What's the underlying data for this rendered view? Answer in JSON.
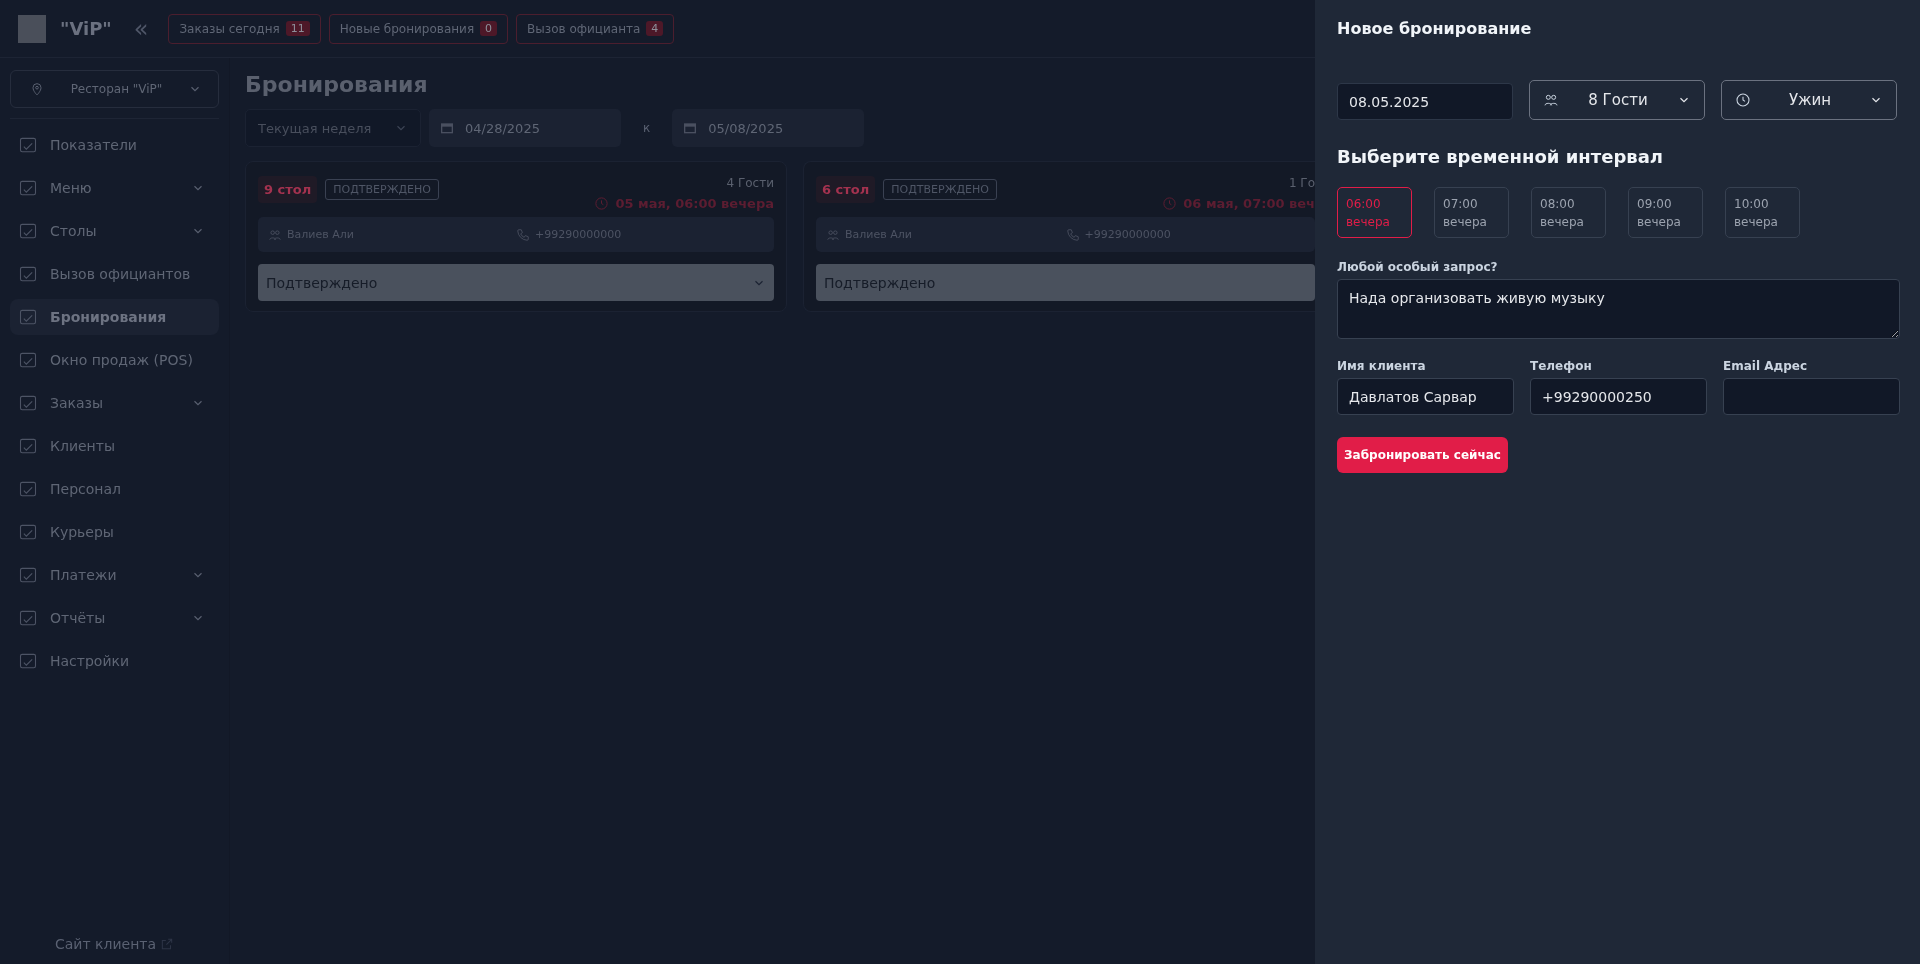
{
  "header": {
    "brand": "\"ViP\"",
    "collapse": "«",
    "badges": [
      {
        "label": "Заказы сегодня",
        "count": "11"
      },
      {
        "label": "Новые бронирования",
        "count": "0"
      },
      {
        "label": "Вызов официанта",
        "count": "4"
      }
    ]
  },
  "sidebar": {
    "restaurant": "Ресторан \"ViP\"",
    "items": [
      {
        "label": "Показатели",
        "expandable": false,
        "selected": false
      },
      {
        "label": "Меню",
        "expandable": true,
        "selected": false
      },
      {
        "label": "Столы",
        "expandable": true,
        "selected": false
      },
      {
        "label": "Вызов официантов",
        "expandable": false,
        "selected": false
      },
      {
        "label": "Бронирования",
        "expandable": false,
        "selected": true
      },
      {
        "label": "Окно продаж (POS)",
        "expandable": false,
        "selected": false
      },
      {
        "label": "Заказы",
        "expandable": true,
        "selected": false
      },
      {
        "label": "Клиенты",
        "expandable": false,
        "selected": false
      },
      {
        "label": "Персонал",
        "expandable": false,
        "selected": false
      },
      {
        "label": "Курьеры",
        "expandable": false,
        "selected": false
      },
      {
        "label": "Платежи",
        "expandable": true,
        "selected": false
      },
      {
        "label": "Отчёты",
        "expandable": true,
        "selected": false
      },
      {
        "label": "Настройки",
        "expandable": false,
        "selected": false
      }
    ],
    "footer_link": "Сайт клиента"
  },
  "main": {
    "title": "Бронирования",
    "filters": {
      "period": "Текущая неделя",
      "from": "04/28/2025",
      "separator": "к",
      "to": "05/08/2025"
    },
    "bookings": [
      {
        "table": "9 стол",
        "status": "ПОДТВЕРЖДЕНО",
        "guests": "4 Гости",
        "time": "05 мая, 06:00 вечера",
        "client": "Валиев Али",
        "phone": "+99290000000",
        "status_select": "Подтверждено"
      },
      {
        "table": "6 стол",
        "status": "ПОДТВЕРЖДЕНО",
        "guests": "1 Го",
        "time": "06 мая, 07:00 веч",
        "client": "Валиев Али",
        "phone": "+99290000000",
        "status_select": "Подтверждено"
      }
    ]
  },
  "drawer": {
    "title": "Новое бронирование",
    "date": "08.05.2025",
    "guests": "8 Гости",
    "meal": "Ужин",
    "slots_heading": "Выберите временной интервал",
    "slots": [
      {
        "time": "06:00",
        "period": "вечера",
        "selected": true
      },
      {
        "time": "07:00",
        "period": "вечера",
        "selected": false
      },
      {
        "time": "08:00",
        "period": "вечера",
        "selected": false
      },
      {
        "time": "09:00",
        "period": "вечера",
        "selected": false
      },
      {
        "time": "10:00",
        "period": "вечера",
        "selected": false
      }
    ],
    "request_label": "Любой особый запрос?",
    "request": "Нада организовать живую музыку",
    "fields": [
      {
        "label": "Имя клиента",
        "value": "Давлатов Сарвар"
      },
      {
        "label": "Телефон",
        "value": "+99290000250"
      },
      {
        "label": "Email Адрес"
      }
    ],
    "submit": "Забронировать сейчас"
  }
}
